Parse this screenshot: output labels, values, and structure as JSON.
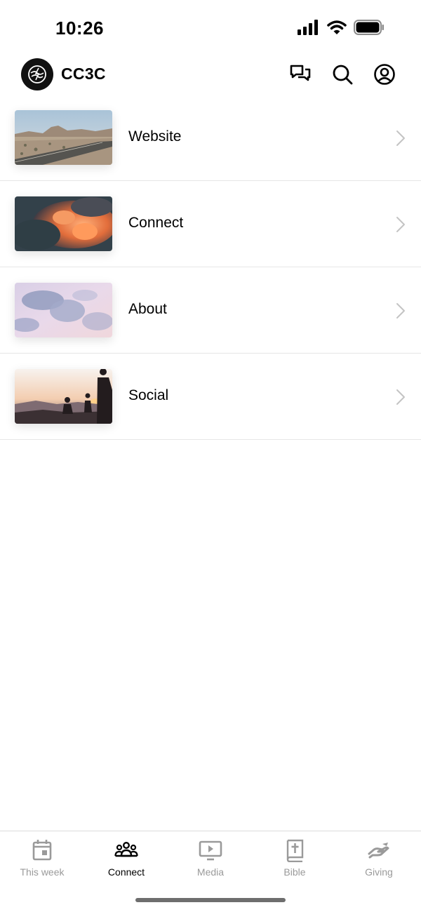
{
  "status_bar": {
    "time": "10:26",
    "icons": [
      "signal-icon",
      "wifi-icon",
      "battery-icon"
    ]
  },
  "header": {
    "title": "CC3C",
    "actions": [
      "chat-icon",
      "search-icon",
      "profile-icon"
    ]
  },
  "list": {
    "items": [
      {
        "label": "Website",
        "image": "desert-road-photo"
      },
      {
        "label": "Connect",
        "image": "sunset-clouds-photo"
      },
      {
        "label": "About",
        "image": "pastel-sky-photo"
      },
      {
        "label": "Social",
        "image": "mountain-sunset-silhouettes-photo"
      }
    ]
  },
  "tab_bar": {
    "tabs": [
      {
        "label": "This week",
        "icon": "calendar-icon",
        "active": false
      },
      {
        "label": "Connect",
        "icon": "people-icon",
        "active": true
      },
      {
        "label": "Media",
        "icon": "video-icon",
        "active": false
      },
      {
        "label": "Bible",
        "icon": "bible-icon",
        "active": false
      },
      {
        "label": "Giving",
        "icon": "giving-hand-icon",
        "active": false
      }
    ]
  },
  "colors": {
    "active_tab": "#000000",
    "inactive_tab": "#9a9a9a",
    "divider": "#e6e6e6"
  }
}
